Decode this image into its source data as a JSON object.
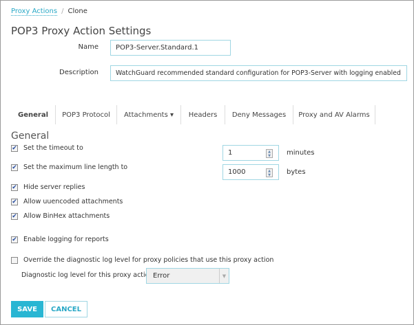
{
  "breadcrumb": {
    "parent": "Proxy Actions",
    "separator": "/",
    "current": "Clone"
  },
  "title": "POP3 Proxy Action Settings",
  "form": {
    "name_label": "Name",
    "name_value": "POP3-Server.Standard.1",
    "description_label": "Description",
    "description_value": "WatchGuard recommended standard configuration for POP3-Server with logging enabled"
  },
  "tabs": [
    {
      "label": "General",
      "active": true
    },
    {
      "label": "POP3 Protocol"
    },
    {
      "label": "Attachments ▾"
    },
    {
      "label": "Headers"
    },
    {
      "label": "Deny Messages"
    },
    {
      "label": "Proxy and AV Alarms"
    }
  ],
  "section_title": "General",
  "options": [
    {
      "label": "Set the timeout to",
      "checked": true
    },
    {
      "label": "Set the maximum line length to",
      "checked": true
    },
    {
      "label": "Hide server replies",
      "checked": true
    },
    {
      "label": "Allow uuencoded attachments",
      "checked": true
    },
    {
      "label": "Allow BinHex attachments",
      "checked": true
    },
    {
      "label": "Enable logging for reports",
      "checked": true
    },
    {
      "label": "Override the diagnostic log level for proxy policies that use this proxy action",
      "checked": false
    }
  ],
  "timeout": {
    "value": "1",
    "unit": "minutes"
  },
  "max_line": {
    "value": "1000",
    "unit": "bytes"
  },
  "log_level": {
    "label": "Diagnostic log level for this proxy action",
    "value": "Error"
  },
  "buttons": {
    "save": "SAVE",
    "cancel": "CANCEL"
  },
  "colors": {
    "accent": "#29b6d3"
  }
}
